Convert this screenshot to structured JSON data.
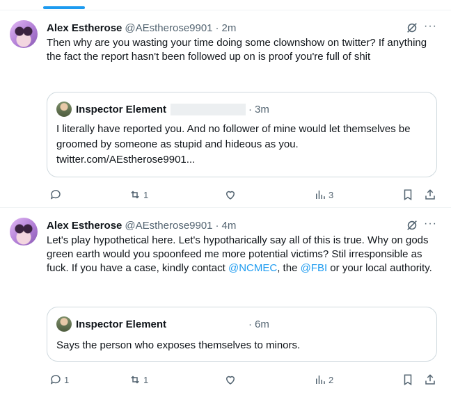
{
  "tweets": [
    {
      "author_name": "Alex Estherose",
      "handle": "@AEstherose9901",
      "time": "2m",
      "text": "Then why are you wasting your time doing some clownshow on twitter? If anything the fact the report hasn't been followed up on is proof you're full of shit",
      "quote": {
        "author_name": "Inspector Element",
        "time": "3m",
        "text": "I literally have reported you. And no follower of mine would let themselves be groomed by someone as stupid and hideous as you.",
        "link": "twitter.com/AEstherose9901..."
      },
      "actions": {
        "replies": "",
        "retweets": "1",
        "likes": "",
        "views": "3"
      }
    },
    {
      "author_name": "Alex Estherose",
      "handle": "@AEstherose9901",
      "time": "4m",
      "text_parts": {
        "before": "Let's play hypothetical here. Let's hypotharically say all of this is true. Why on gods green earth would you spoonfeed me more potential victims? Stil irresponsible as fuck. If you have a case, kindly contact ",
        "mention1": "@NCMEC",
        "middle": ", the ",
        "mention2": "@FBI",
        "after": " or your local authority."
      },
      "quote": {
        "author_name": "Inspector Element",
        "time": "6m",
        "text": "Says the person who exposes themselves to minors."
      },
      "actions": {
        "replies": "1",
        "retweets": "1",
        "likes": "",
        "views": "2"
      }
    }
  ],
  "ui": {
    "separator": "·",
    "more": "···"
  }
}
